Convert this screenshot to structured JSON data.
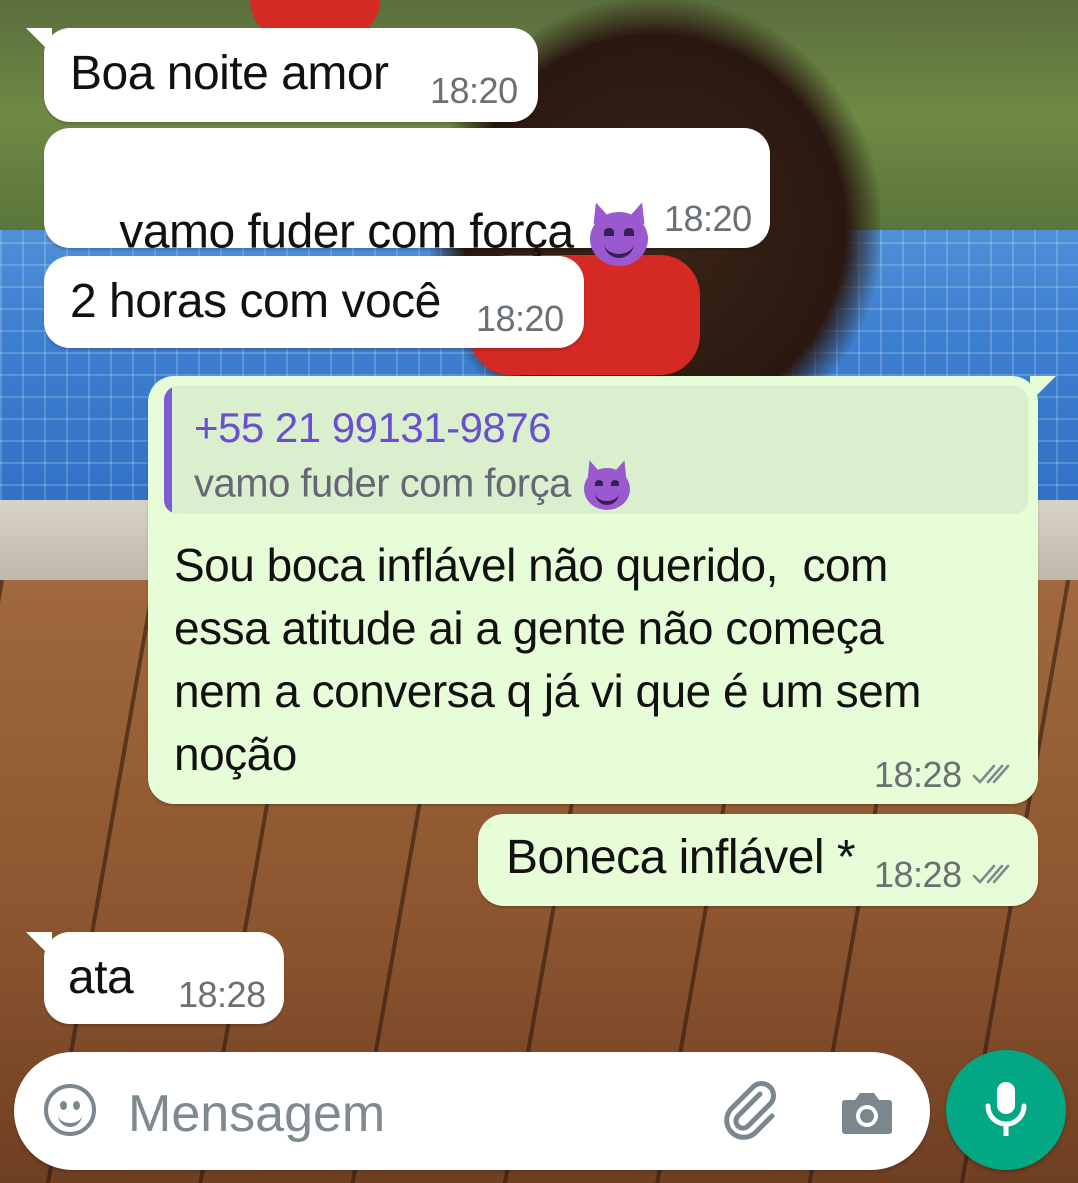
{
  "messages": [
    {
      "direction": "in",
      "text": "Boa noite amor",
      "time": "18:20"
    },
    {
      "direction": "in",
      "text": "vamo fuder com força",
      "emoji": "smiling-face-with-horns",
      "time": "18:20"
    },
    {
      "direction": "in",
      "text": "2 horas com você",
      "time": "18:20"
    },
    {
      "direction": "out",
      "quoted": {
        "author": "+55 21 99131-9876",
        "text": "vamo fuder com força",
        "emoji": "smiling-face-with-horns"
      },
      "lines": [
        "Sou boca inflável não querido,  com",
        "essa atitude ai a gente não começa",
        "nem a conversa q já vi que é um sem",
        "noção"
      ],
      "time": "18:28",
      "status": "delivered-double-check"
    },
    {
      "direction": "out",
      "text": "Boneca inflável *",
      "time": "18:28",
      "status": "delivered-double-check"
    },
    {
      "direction": "in",
      "text": "ata",
      "time": "18:28"
    }
  ],
  "composer": {
    "placeholder": "Mensagem",
    "icons": [
      "emoji-icon",
      "attach-icon",
      "camera-icon",
      "mic-icon"
    ]
  },
  "colors": {
    "incoming_bubble": "#ffffff",
    "outgoing_bubble": "#e7fdd8",
    "quote_accent": "#7f5ad6",
    "mic_button": "#03a784",
    "timestamp": "#6a7074"
  }
}
